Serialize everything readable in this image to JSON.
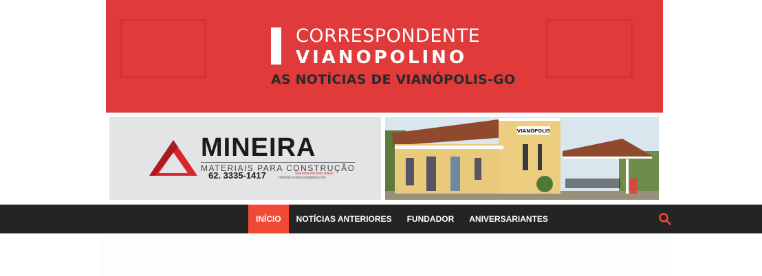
{
  "header": {
    "logo_line1": "CORRESPONDENTE",
    "logo_line2": "VIANOPOLINO",
    "tagline": "AS NOTÍCIAS DE VIANÓPOLIS-GO",
    "banner_color": "#e03a3a"
  },
  "ad": {
    "brand": "MINEIRA",
    "subtitle": "MATERIAIS PARA CONSTRUÇÃO",
    "phone": "62. 3335-1417",
    "slogan": "Sua obra em boas mãos!",
    "email": "mineiraconstrucao@gmail.com",
    "logo_icon": "triangle-logo-icon"
  },
  "photo": {
    "sign_text": "VIANÓPOLIS"
  },
  "nav": {
    "items": [
      {
        "label": "INÍCIO",
        "active": true
      },
      {
        "label": "NOTÍCIAS ANTERIORES",
        "active": false
      },
      {
        "label": "FUNDADOR",
        "active": false
      },
      {
        "label": "ANIVERSARIANTES",
        "active": false
      }
    ],
    "search_icon": "search-icon",
    "active_color": "#f04a36",
    "bar_color": "#242424"
  }
}
